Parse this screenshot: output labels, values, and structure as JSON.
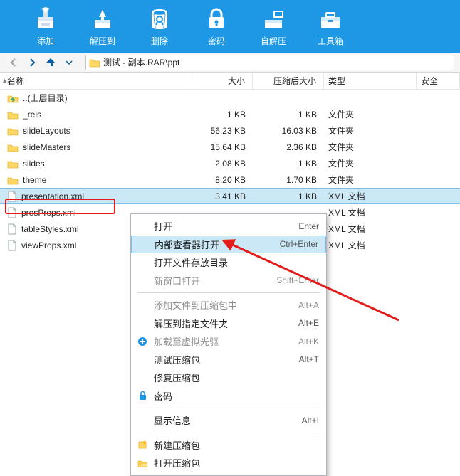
{
  "toolbar": {
    "add": "添加",
    "extract": "解压到",
    "delete": "删除",
    "password": "密码",
    "sfx": "自解压",
    "toolbox": "工具箱"
  },
  "path": "测试 - 副本.RAR\\ppt",
  "columns": {
    "name": "名称",
    "size": "大小",
    "comp": "压缩后大小",
    "type": "类型",
    "safe": "安全"
  },
  "rows": [
    {
      "icon": "up",
      "name": "..(上层目录)",
      "size": "",
      "comp": "",
      "type": ""
    },
    {
      "icon": "folder",
      "name": "_rels",
      "size": "1 KB",
      "comp": "1 KB",
      "type": "文件夹"
    },
    {
      "icon": "folder",
      "name": "slideLayouts",
      "size": "56.23 KB",
      "comp": "16.03 KB",
      "type": "文件夹"
    },
    {
      "icon": "folder",
      "name": "slideMasters",
      "size": "15.64 KB",
      "comp": "2.36 KB",
      "type": "文件夹"
    },
    {
      "icon": "folder",
      "name": "slides",
      "size": "2.08 KB",
      "comp": "1 KB",
      "type": "文件夹"
    },
    {
      "icon": "folder",
      "name": "theme",
      "size": "8.20 KB",
      "comp": "1.70 KB",
      "type": "文件夹"
    },
    {
      "icon": "file",
      "name": "presentation.xml",
      "size": "3.41 KB",
      "comp": "1 KB",
      "type": "XML 文档",
      "selected": true
    },
    {
      "icon": "file",
      "name": "presProps.xml",
      "size": "",
      "comp": "",
      "type": "XML 文档"
    },
    {
      "icon": "file",
      "name": "tableStyles.xml",
      "size": "",
      "comp": "",
      "type": "XML 文档"
    },
    {
      "icon": "file",
      "name": "viewProps.xml",
      "size": "",
      "comp": "",
      "type": "XML 文档"
    }
  ],
  "ctx": [
    {
      "text": "打开",
      "short": "Enter"
    },
    {
      "text": "内部查看器打开",
      "short": "Ctrl+Enter",
      "hover": true
    },
    {
      "text": "打开文件存放目录",
      "short": ""
    },
    {
      "text": "新窗口打开",
      "short": "Shift+Enter",
      "disabled": true
    },
    {
      "sep": true
    },
    {
      "text": "添加文件到压缩包中",
      "short": "Alt+A",
      "disabled": true
    },
    {
      "text": "解压到指定文件夹",
      "short": "Alt+E"
    },
    {
      "icon": "plus",
      "text": "加载至虚拟光驱",
      "short": "Alt+K",
      "disabled": true
    },
    {
      "text": "测试压缩包",
      "short": "Alt+T"
    },
    {
      "text": "修复压缩包",
      "short": ""
    },
    {
      "icon": "lock",
      "text": "密码",
      "short": ""
    },
    {
      "sep": true
    },
    {
      "text": "显示信息",
      "short": "Alt+I"
    },
    {
      "sep": true
    },
    {
      "icon": "new",
      "text": "新建压缩包",
      "short": ""
    },
    {
      "icon": "open",
      "text": "打开压缩包",
      "short": ""
    }
  ]
}
